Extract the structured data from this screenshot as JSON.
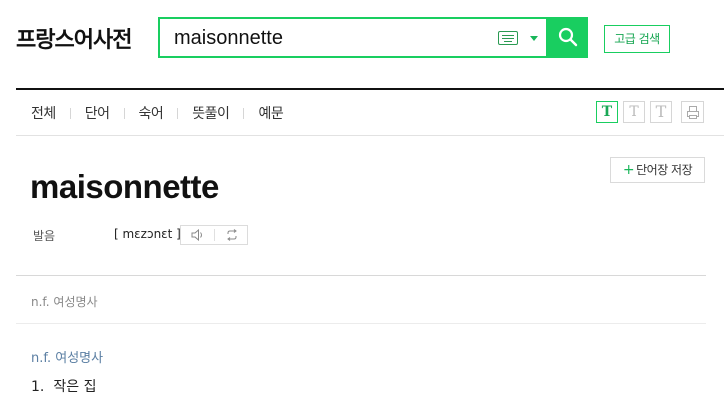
{
  "header": {
    "site_title": "프랑스어사전",
    "search_value": "maisonnette",
    "advanced_search_label": "고급 검색"
  },
  "tabs": [
    {
      "label": "전체"
    },
    {
      "label": "단어"
    },
    {
      "label": "숙어"
    },
    {
      "label": "뜻풀이"
    },
    {
      "label": "예문"
    }
  ],
  "font_size_buttons": [
    "T",
    "T",
    "T"
  ],
  "entry": {
    "save_label": "단어장 저장",
    "headword": "maisonnette",
    "pron_label": "발음",
    "pronunciation": "[ mɛzɔnɛt ]",
    "pos_summary": "n.f. 여성명사",
    "pos_heading": "n.f. 여성명사",
    "meaning_number": "1.",
    "meaning_text": "작은 집"
  },
  "colors": {
    "accent": "#19ce60",
    "pos_link": "#5b7fa3"
  }
}
